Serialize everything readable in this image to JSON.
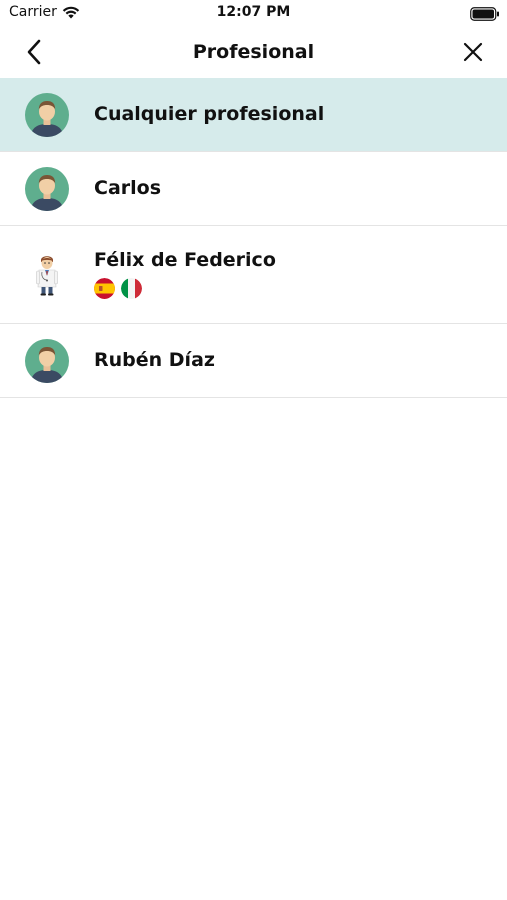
{
  "status_bar": {
    "carrier": "Carrier",
    "time": "12:07 PM",
    "icons": [
      "wifi-icon",
      "battery-icon"
    ]
  },
  "header": {
    "title": "Profesional",
    "back_icon": "chevron-left-icon",
    "close_icon": "close-icon"
  },
  "professionals": [
    {
      "name": "Cualquier profesional",
      "avatar": "avatar-default",
      "selected": true
    },
    {
      "name": "Carlos",
      "avatar": "avatar-default",
      "selected": false
    },
    {
      "name": "Félix de Federico",
      "avatar": "doctor-avatar",
      "selected": false,
      "languages": [
        "spain-flag-icon",
        "italy-flag-icon"
      ]
    },
    {
      "name": "Rubén Díaz",
      "avatar": "avatar-default",
      "selected": false
    }
  ],
  "colors": {
    "selected_row": "#d6ebeb",
    "avatar_bg": "#5fae8e",
    "divider": "#e4e4e4"
  }
}
